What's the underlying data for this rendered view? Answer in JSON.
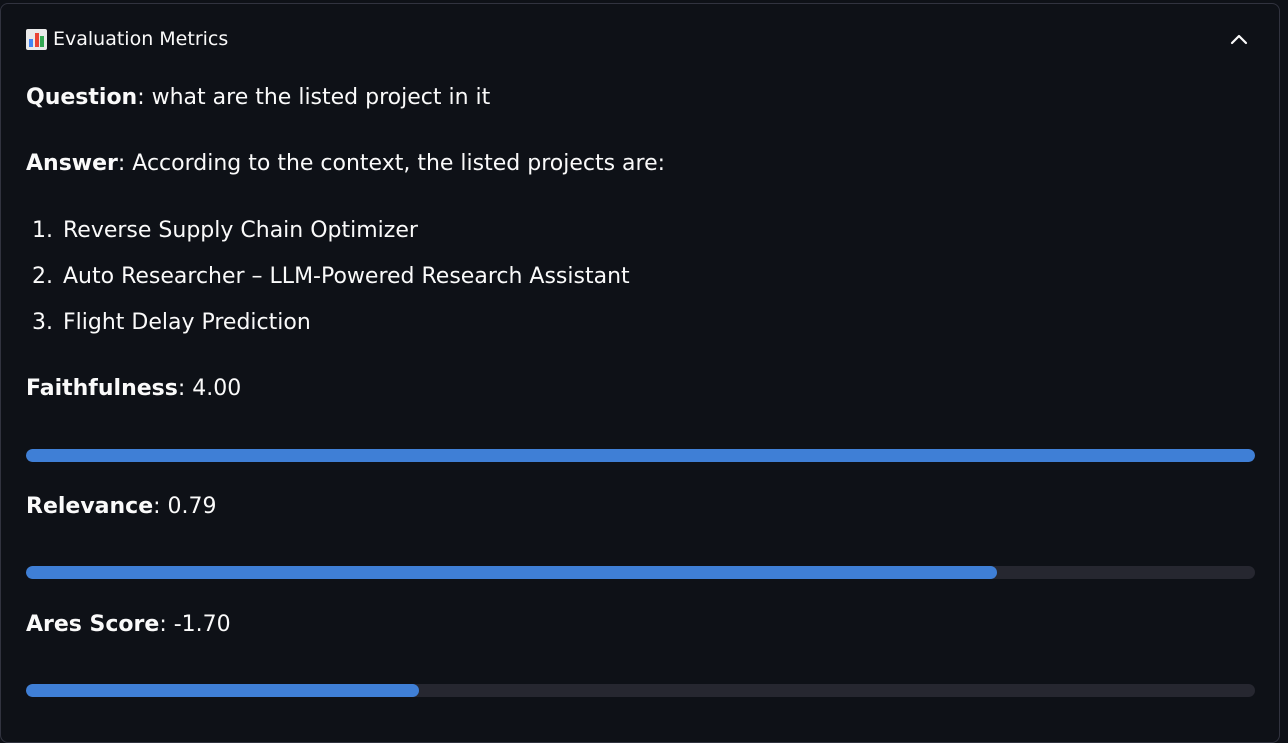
{
  "expander": {
    "icon": "bar-chart-icon",
    "title": "Evaluation Metrics",
    "toggle_icon": "chevron-up-icon"
  },
  "question": {
    "label": "Question",
    "text": ": what are the listed project in it"
  },
  "answer": {
    "label": "Answer",
    "text": ": According to the context, the listed projects are:",
    "items": [
      {
        "num": "1.",
        "text": "Reverse Supply Chain Optimizer"
      },
      {
        "num": "2.",
        "text": "Auto Researcher – LLM-Powered Research Assistant"
      },
      {
        "num": "3.",
        "text": "Flight Delay Prediction"
      }
    ]
  },
  "metrics": [
    {
      "label": "Faithfulness",
      "value_text": ": 4.00",
      "progress": 1.0
    },
    {
      "label": "Relevance",
      "value_text": ": 0.79",
      "progress": 0.79
    },
    {
      "label": "Ares Score",
      "value_text": ": -1.70",
      "progress": 0.32
    }
  ],
  "colors": {
    "background": "#0e1117",
    "progress_fill": "#3f7fd6",
    "progress_track": "#262730",
    "border": "#31333f"
  }
}
